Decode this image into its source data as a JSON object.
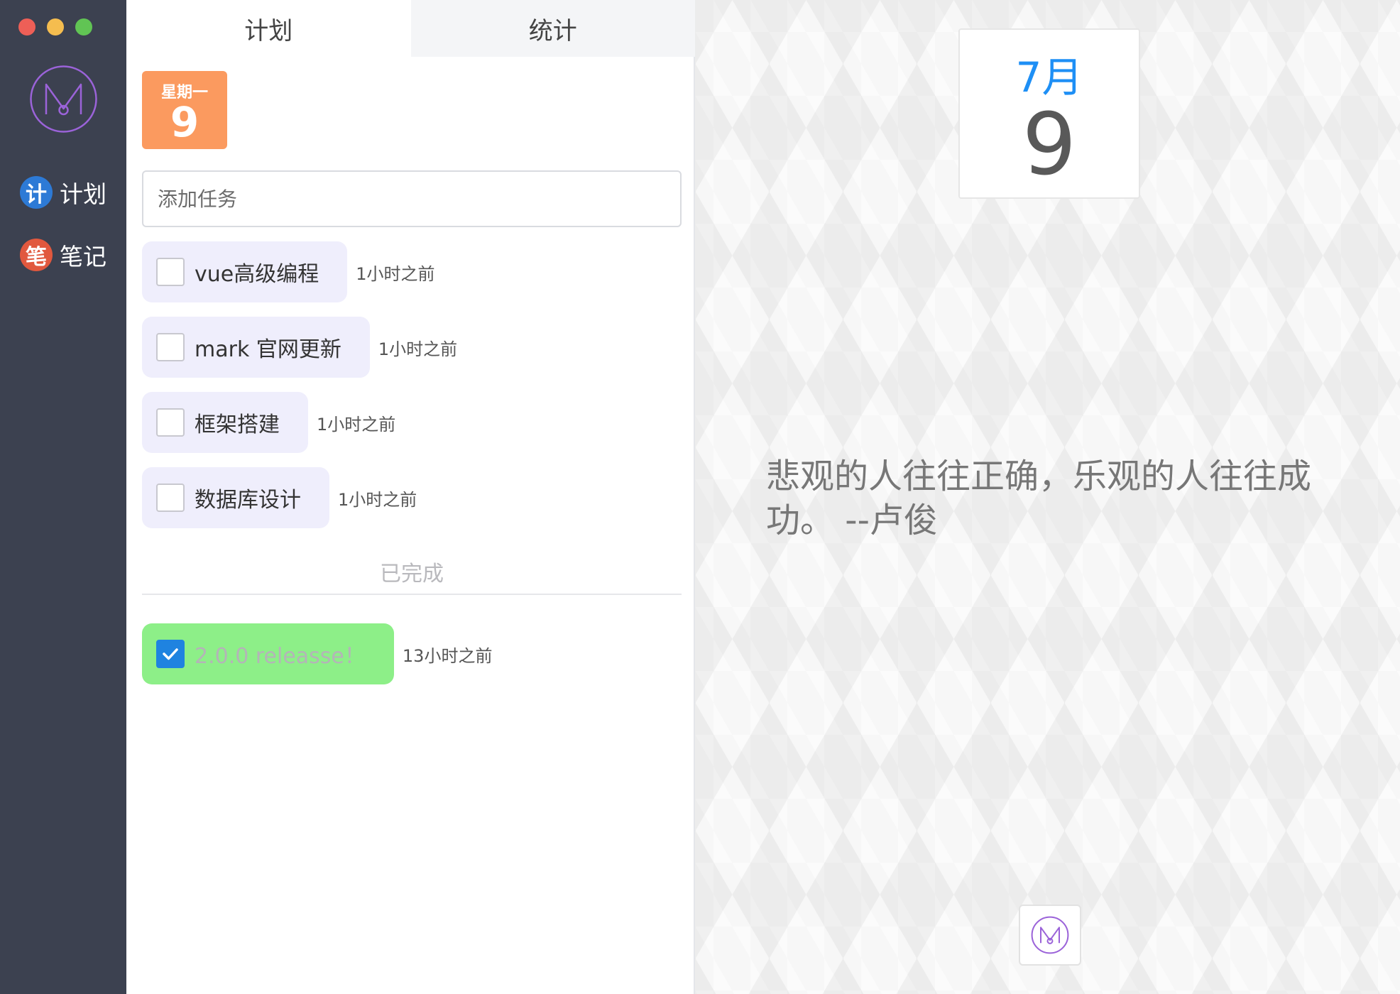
{
  "window": {
    "controls": [
      "close",
      "minimize",
      "zoom"
    ]
  },
  "app_logo": {
    "letter": "M"
  },
  "sidebar": {
    "items": [
      {
        "badge": "计",
        "label": "计划",
        "badge_color": "#2d7ad6"
      },
      {
        "badge": "笔",
        "label": "笔记",
        "badge_color": "#e1583e"
      }
    ]
  },
  "tabs": [
    {
      "label": "计划",
      "active": true
    },
    {
      "label": "统计",
      "active": false
    }
  ],
  "day_badge": {
    "weekday": "星期一",
    "day": "9"
  },
  "add_task": {
    "placeholder": "添加任务"
  },
  "tasks": [
    {
      "label": "vue高级编程",
      "time": "1小时之前",
      "done": false
    },
    {
      "label": "mark 官网更新",
      "time": "1小时之前",
      "done": false
    },
    {
      "label": "框架搭建",
      "time": "1小时之前",
      "done": false
    },
    {
      "label": "数据库设计",
      "time": "1小时之前",
      "done": false
    }
  ],
  "completed": {
    "heading": "已完成",
    "tasks": [
      {
        "label": "2.0.0 releasse！",
        "time": "13小时之前",
        "done": true
      }
    ]
  },
  "calendar": {
    "month": "7月",
    "day": "9"
  },
  "quote": {
    "text": "悲观的人往往正确，乐观的人往往成功。 --卢俊"
  },
  "colors": {
    "sidebar_bg": "#3c4150",
    "accent_orange": "#fb9a5f",
    "accent_blue": "#1e8ff5",
    "task_bg": "#efeefc",
    "done_bg": "#8def88",
    "logo_purple": "#9b63d9"
  }
}
